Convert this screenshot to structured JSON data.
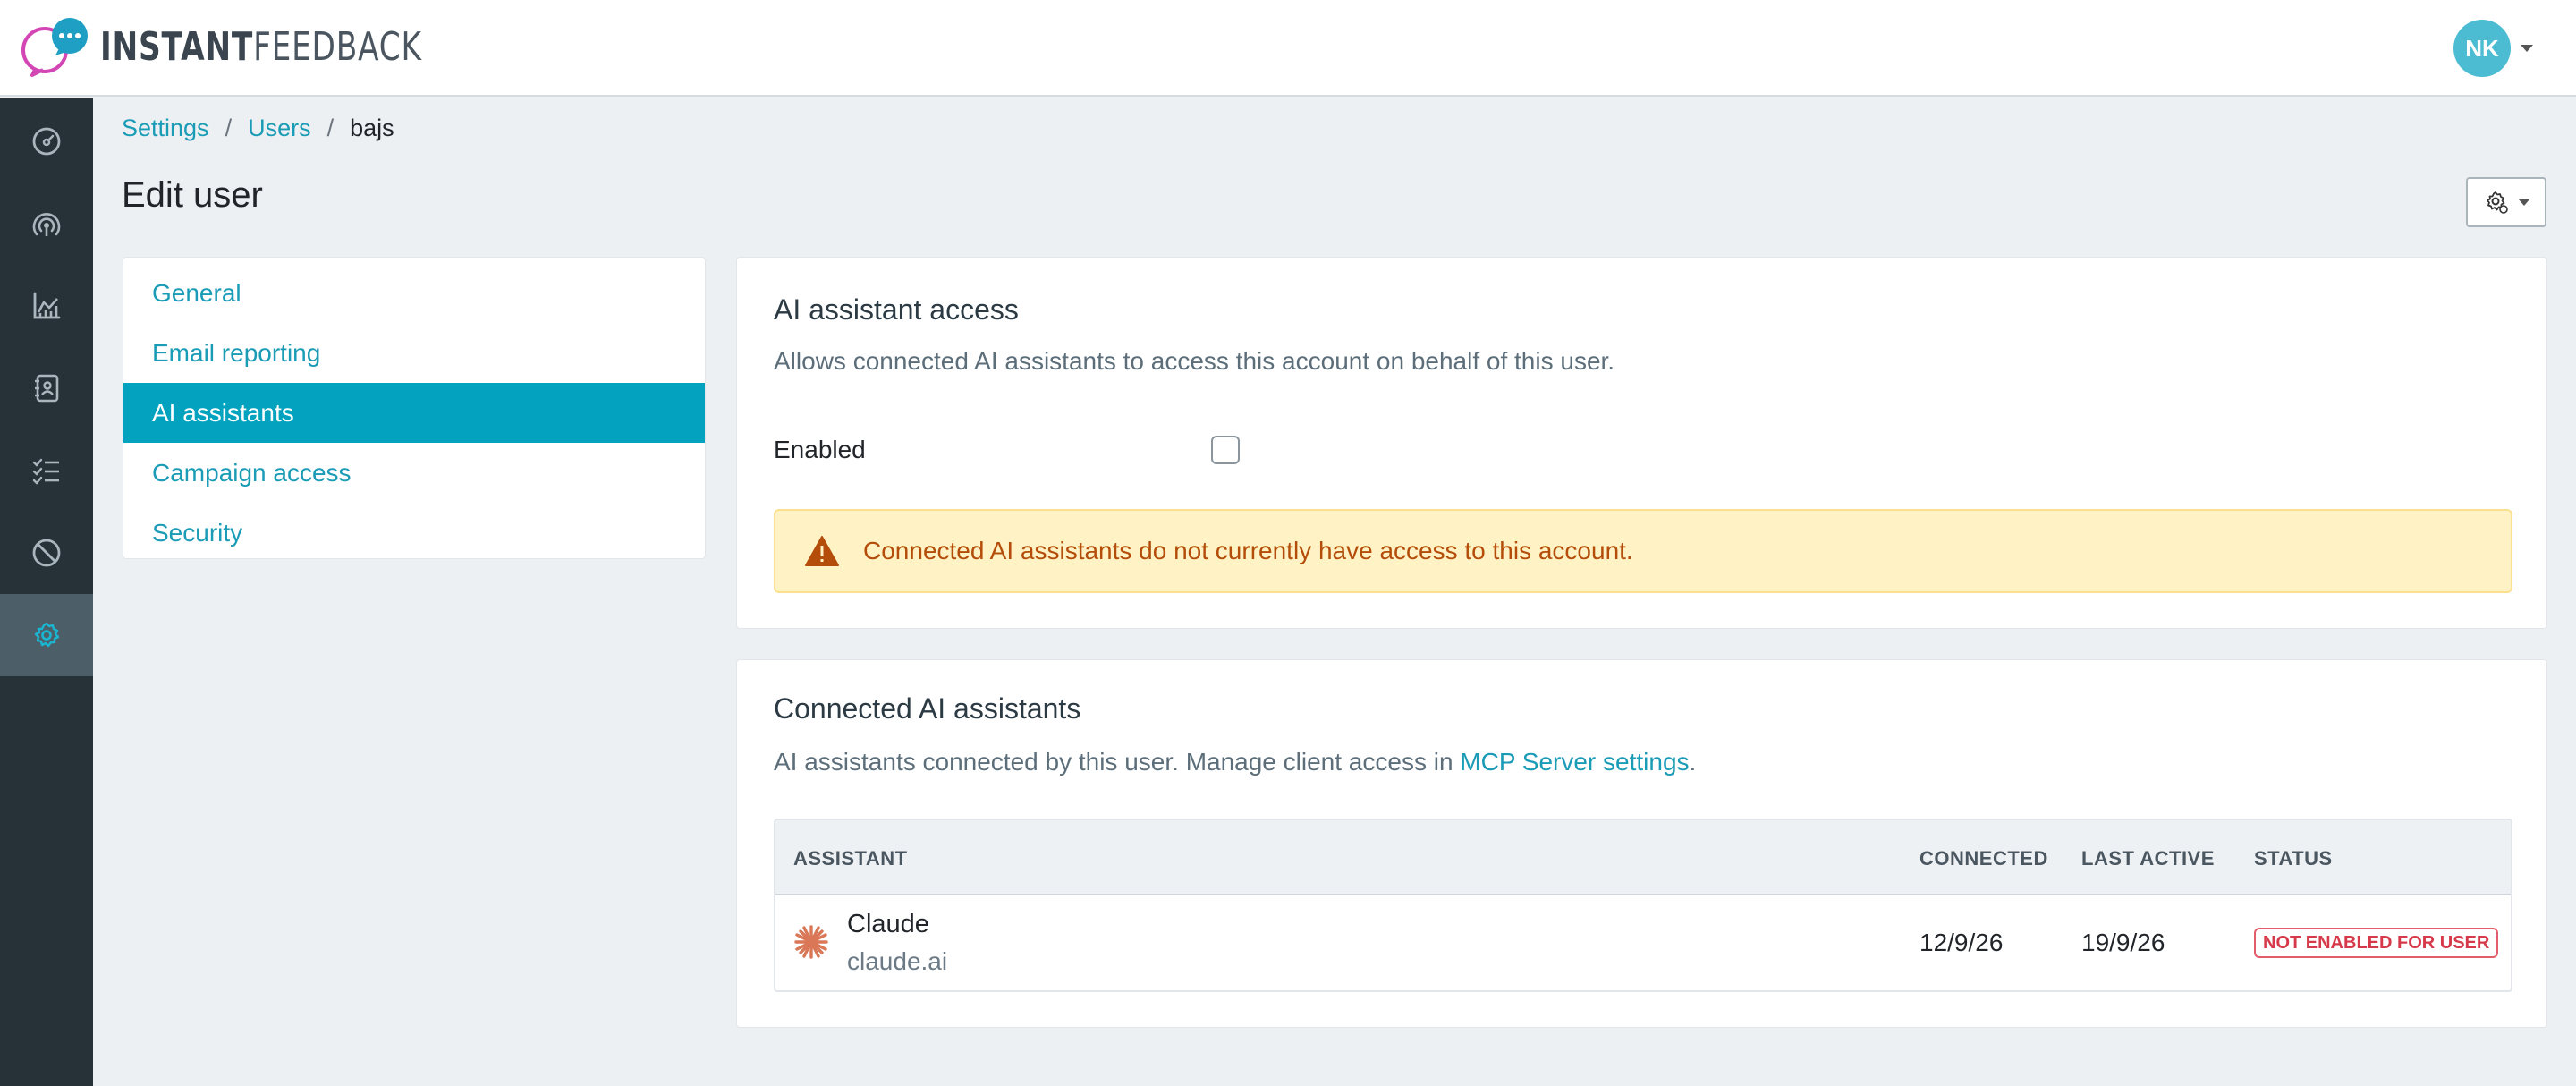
{
  "app": {
    "logo_text_bold": "INSTANT",
    "logo_text_light": "FEEDBACK",
    "brand_color": "#03a3bf"
  },
  "user_menu": {
    "initials": "NK"
  },
  "sidenav": {
    "items": [
      {
        "name": "dashboard",
        "icon": "gauge-icon"
      },
      {
        "name": "broadcast",
        "icon": "signal-icon"
      },
      {
        "name": "analytics",
        "icon": "chart-icon"
      },
      {
        "name": "contacts",
        "icon": "contacts-book-icon"
      },
      {
        "name": "tasks",
        "icon": "checklist-icon"
      },
      {
        "name": "blocked",
        "icon": "ban-icon"
      },
      {
        "name": "settings",
        "icon": "gear-icon",
        "active": true
      }
    ]
  },
  "breadcrumb": {
    "items": [
      "Settings",
      "Users"
    ],
    "current": "bajs",
    "separator": "/"
  },
  "page": {
    "title": "Edit user"
  },
  "side_menu": {
    "items": [
      {
        "label": "General"
      },
      {
        "label": "Email reporting"
      },
      {
        "label": "AI assistants",
        "active": true
      },
      {
        "label": "Campaign access"
      },
      {
        "label": "Security"
      }
    ]
  },
  "access_card": {
    "title": "AI assistant access",
    "description": "Allows connected AI assistants to access this account on behalf of this user.",
    "enabled_label": "Enabled",
    "enabled": false,
    "alert": "Connected AI assistants do not currently have access to this account."
  },
  "connected_card": {
    "title": "Connected AI assistants",
    "description_prefix": "AI assistants connected by this user. Manage client access in ",
    "description_link": "MCP Server settings",
    "description_suffix": ".",
    "table": {
      "headers": [
        "ASSISTANT",
        "CONNECTED",
        "LAST ACTIVE",
        "STATUS"
      ],
      "rows": [
        {
          "name": "Claude",
          "domain": "claude.ai",
          "connected": "12/9/26",
          "last_active": "19/9/26",
          "status": "NOT ENABLED FOR USER",
          "status_color": "#d63a4a"
        }
      ]
    }
  }
}
